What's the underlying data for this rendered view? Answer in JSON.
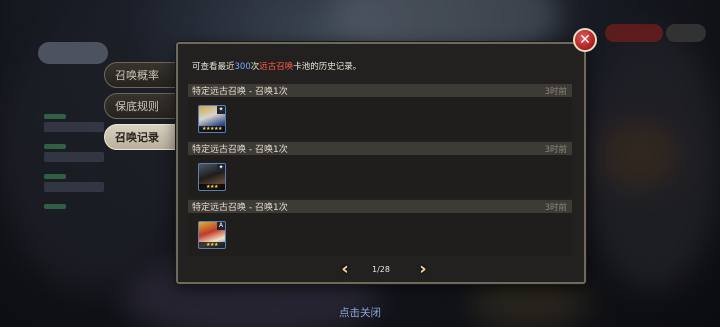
{
  "side_tabs": [
    {
      "label": "召唤概率",
      "active": false
    },
    {
      "label": "保底规则",
      "active": false
    },
    {
      "label": "召唤记录",
      "active": true
    }
  ],
  "popup": {
    "info": {
      "prefix": "可查看最近",
      "count": "300",
      "count_unit": "次",
      "pool": "远古召唤",
      "suffix": "卡池的历史记录。"
    },
    "records": [
      {
        "title": "特定远古召唤 - 召唤1次",
        "time": "3时前",
        "unit_icon": "hero-portrait-icon",
        "badge": "",
        "stars": "★★★★★"
      },
      {
        "title": "特定远古召唤 - 召唤1次",
        "time": "3时前",
        "unit_icon": "hero-portrait-icon",
        "badge": "",
        "stars": "★★★"
      },
      {
        "title": "特定远古召唤 - 召唤1次",
        "time": "3时前",
        "unit_icon": "hero-portrait-icon",
        "badge": "A",
        "stars": "★★★"
      }
    ],
    "pager": {
      "text": "1/28",
      "prev_icon": "double-chevron-left-icon",
      "next_icon": "double-chevron-right-icon"
    },
    "close_icon": "close-icon"
  },
  "footer": {
    "click_close": "点击关闭"
  },
  "colors": {
    "highlight_count": "#7aa9ff",
    "highlight_pool": "#ff5a4a",
    "close_button": "#c0392b",
    "pager_arrows": "#e7d39a"
  }
}
